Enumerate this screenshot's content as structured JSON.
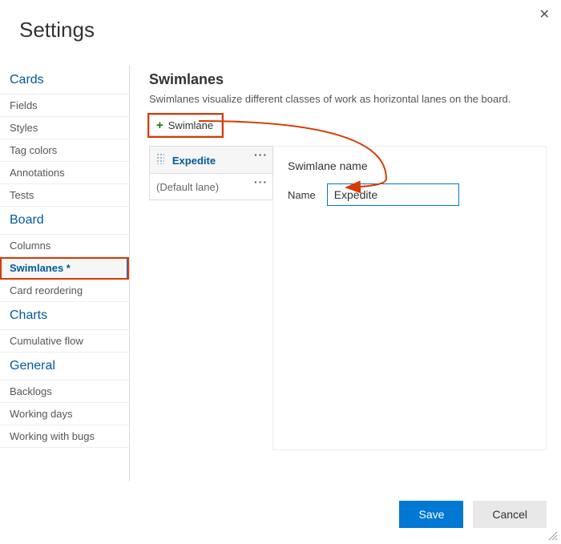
{
  "title": "Settings",
  "close_label": "✕",
  "sidebar": {
    "sections": [
      {
        "header": "Cards",
        "items": [
          {
            "label": "Fields"
          },
          {
            "label": "Styles"
          },
          {
            "label": "Tag colors"
          },
          {
            "label": "Annotations"
          },
          {
            "label": "Tests"
          }
        ]
      },
      {
        "header": "Board",
        "items": [
          {
            "label": "Columns"
          },
          {
            "label": "Swimlanes *",
            "active": true,
            "highlight": true
          },
          {
            "label": "Card reordering"
          }
        ]
      },
      {
        "header": "Charts",
        "items": [
          {
            "label": "Cumulative flow"
          }
        ]
      },
      {
        "header": "General",
        "items": [
          {
            "label": "Backlogs"
          },
          {
            "label": "Working days"
          },
          {
            "label": "Working with bugs"
          }
        ]
      }
    ]
  },
  "content": {
    "heading": "Swimlanes",
    "description": "Swimlanes visualize different classes of work as horizontal lanes on the board.",
    "add_btn_label": "Swimlane",
    "add_btn_icon": "+",
    "lanes": [
      {
        "name": "Expedite",
        "default": false,
        "active": true
      },
      {
        "name": "(Default lane)",
        "default": true,
        "active": false
      }
    ],
    "detail": {
      "heading": "Swimlane name",
      "name_label": "Name",
      "name_value": "Expedite"
    }
  },
  "footer": {
    "save_label": "Save",
    "cancel_label": "Cancel"
  },
  "more_glyph": "···"
}
